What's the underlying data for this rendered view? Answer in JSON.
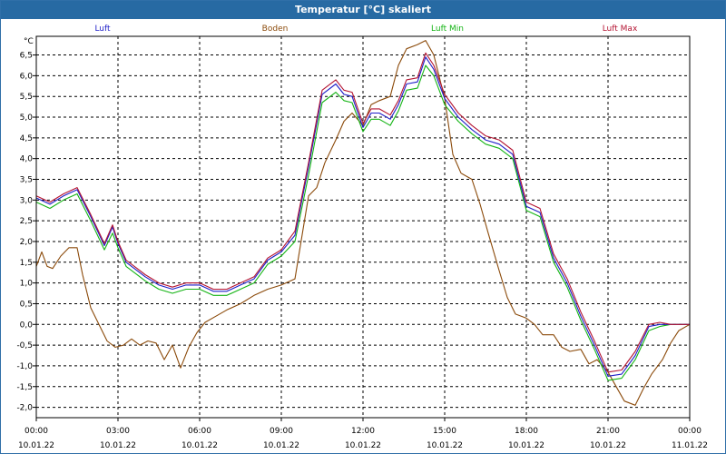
{
  "window": {
    "title": "Temperatur [°C] skaliert"
  },
  "colors": {
    "luft": "#1e1ec8",
    "boden": "#8b4a0a",
    "luft_min": "#14b414",
    "luft_max": "#b41432",
    "grid": "#000000"
  },
  "chart_data": {
    "type": "line",
    "title": "Temperatur [°C] skaliert",
    "ylabel": "°C",
    "xlabel": "",
    "xlim": [
      0,
      24
    ],
    "ylim": [
      -2.25,
      6.95
    ],
    "grid": true,
    "legend_position": "top",
    "y_ticks": [
      "6,5",
      "6,0",
      "5,5",
      "5,0",
      "4,5",
      "4,0",
      "3,5",
      "3,0",
      "2,5",
      "2,0",
      "1,5",
      "1,0",
      "0,5",
      "0,0",
      "-0,5",
      "-1,0",
      "-1,5",
      "-2,0"
    ],
    "y_tick_values": [
      6.5,
      6.0,
      5.5,
      5.0,
      4.5,
      4.0,
      3.5,
      3.0,
      2.5,
      2.0,
      1.5,
      1.0,
      0.5,
      0.0,
      -0.5,
      -1.0,
      -1.5,
      -2.0
    ],
    "x_ticks": [
      {
        "time": "00:00",
        "date": "10.01.22"
      },
      {
        "time": "03:00",
        "date": "10.01.22"
      },
      {
        "time": "06:00",
        "date": "10.01.22"
      },
      {
        "time": "09:00",
        "date": "10.01.22"
      },
      {
        "time": "12:00",
        "date": "10.01.22"
      },
      {
        "time": "15:00",
        "date": "10.01.22"
      },
      {
        "time": "18:00",
        "date": "10.01.22"
      },
      {
        "time": "21:00",
        "date": "10.01.22"
      },
      {
        "time": "00:00",
        "date": "11.01.22"
      }
    ],
    "x_tick_values": [
      0,
      3,
      6,
      9,
      12,
      15,
      18,
      21,
      24
    ],
    "series": [
      {
        "name": "Luft",
        "color": "#1e1ec8",
        "x": [
          0,
          0.5,
          1,
          1.5,
          2,
          2.5,
          2.8,
          3,
          3.3,
          3.5,
          4,
          4.5,
          5,
          5.5,
          6,
          6.5,
          7,
          7.5,
          8,
          8.5,
          9,
          9.5,
          10,
          10.5,
          11,
          11.3,
          11.6,
          12,
          12.3,
          12.6,
          13,
          13.3,
          13.6,
          14,
          14.3,
          14.6,
          15,
          15.5,
          16,
          16.5,
          17,
          17.5,
          18,
          18.5,
          19,
          19.5,
          20,
          20.5,
          21,
          21.5,
          22,
          22.5,
          22.9,
          23.3,
          23.7,
          24
        ],
        "values": [
          3.05,
          2.9,
          3.1,
          3.25,
          2.6,
          1.9,
          2.35,
          1.95,
          1.5,
          1.4,
          1.15,
          0.95,
          0.85,
          0.95,
          0.95,
          0.8,
          0.8,
          0.95,
          1.1,
          1.55,
          1.75,
          2.15,
          3.8,
          5.55,
          5.8,
          5.55,
          5.5,
          4.75,
          5.1,
          5.1,
          4.95,
          5.3,
          5.8,
          5.85,
          6.45,
          6.15,
          5.45,
          5.0,
          4.7,
          4.45,
          4.35,
          4.1,
          2.85,
          2.7,
          1.6,
          1.0,
          0.2,
          -0.5,
          -1.25,
          -1.2,
          -0.75,
          -0.05,
          0.0,
          0.0,
          0.0,
          0.0
        ]
      },
      {
        "name": "Boden",
        "color": "#8b4a0a",
        "x": [
          0,
          0.2,
          0.4,
          0.6,
          0.9,
          1.2,
          1.5,
          1.7,
          2,
          2.3,
          2.6,
          2.9,
          3.2,
          3.5,
          3.8,
          4.1,
          4.4,
          4.7,
          5,
          5.3,
          5.6,
          5.9,
          6.2,
          6.6,
          7,
          7.5,
          8,
          8.5,
          9,
          9.5,
          10,
          10.3,
          10.6,
          11,
          11.3,
          11.6,
          12,
          12.3,
          12.6,
          13,
          13.3,
          13.6,
          14,
          14.3,
          14.6,
          15,
          15.3,
          15.6,
          16,
          16.3,
          16.6,
          17,
          17.3,
          17.6,
          18,
          18.3,
          18.6,
          19,
          19.3,
          19.6,
          20,
          20.3,
          20.6,
          21,
          21.3,
          21.6,
          22,
          22.3,
          22.6,
          23,
          23.3,
          23.6,
          24
        ],
        "values": [
          1.4,
          1.75,
          1.4,
          1.35,
          1.65,
          1.85,
          1.85,
          1.2,
          0.4,
          0.0,
          -0.4,
          -0.55,
          -0.5,
          -0.35,
          -0.5,
          -0.4,
          -0.45,
          -0.85,
          -0.5,
          -1.05,
          -0.55,
          -0.2,
          0.05,
          0.2,
          0.35,
          0.5,
          0.7,
          0.85,
          0.95,
          1.1,
          3.1,
          3.3,
          3.9,
          4.45,
          4.9,
          5.1,
          4.8,
          5.3,
          5.4,
          5.5,
          6.25,
          6.65,
          6.75,
          6.85,
          6.5,
          5.45,
          4.1,
          3.65,
          3.5,
          2.9,
          2.2,
          1.3,
          0.65,
          0.25,
          0.15,
          0.0,
          -0.25,
          -0.25,
          -0.55,
          -0.65,
          -0.6,
          -0.95,
          -0.85,
          -1.15,
          -1.5,
          -1.85,
          -1.95,
          -1.55,
          -1.2,
          -0.85,
          -0.45,
          -0.15,
          0.0
        ]
      },
      {
        "name": "Luft Min",
        "color": "#14b414",
        "x": [
          0,
          0.5,
          1,
          1.5,
          2,
          2.5,
          2.8,
          3,
          3.3,
          3.5,
          4,
          4.5,
          5,
          5.5,
          6,
          6.5,
          7,
          7.5,
          8,
          8.5,
          9,
          9.5,
          10,
          10.5,
          11,
          11.3,
          11.6,
          12,
          12.3,
          12.6,
          13,
          13.3,
          13.6,
          14,
          14.3,
          14.6,
          15,
          15.5,
          16,
          16.5,
          17,
          17.5,
          18,
          18.5,
          19,
          19.5,
          20,
          20.5,
          21,
          21.5,
          22,
          22.5,
          22.9,
          23.3,
          23.7,
          24
        ],
        "values": [
          2.95,
          2.8,
          3.0,
          3.15,
          2.5,
          1.8,
          2.2,
          1.85,
          1.4,
          1.3,
          1.05,
          0.85,
          0.75,
          0.85,
          0.85,
          0.7,
          0.7,
          0.85,
          1.0,
          1.45,
          1.65,
          2.0,
          3.6,
          5.35,
          5.6,
          5.4,
          5.35,
          4.65,
          4.95,
          4.95,
          4.8,
          5.15,
          5.65,
          5.7,
          6.25,
          6.0,
          5.3,
          4.9,
          4.6,
          4.35,
          4.25,
          4.0,
          2.75,
          2.6,
          1.5,
          0.9,
          0.1,
          -0.6,
          -1.35,
          -1.3,
          -0.85,
          -0.15,
          -0.05,
          0.0,
          0.0,
          0.0
        ]
      },
      {
        "name": "Luft Max",
        "color": "#b41432",
        "x": [
          0,
          0.5,
          1,
          1.5,
          2,
          2.5,
          2.8,
          3,
          3.3,
          3.5,
          4,
          4.5,
          5,
          5.5,
          6,
          6.5,
          7,
          7.5,
          8,
          8.5,
          9,
          9.5,
          10,
          10.5,
          11,
          11.3,
          11.6,
          12,
          12.3,
          12.6,
          13,
          13.3,
          13.6,
          14,
          14.3,
          14.6,
          15,
          15.5,
          16,
          16.5,
          17,
          17.5,
          18,
          18.5,
          19,
          19.5,
          20,
          20.5,
          21,
          21.5,
          22,
          22.5,
          22.9,
          23.3,
          23.7,
          24
        ],
        "values": [
          3.1,
          2.95,
          3.15,
          3.3,
          2.65,
          1.95,
          2.4,
          2.0,
          1.55,
          1.45,
          1.2,
          1.0,
          0.9,
          1.0,
          1.0,
          0.85,
          0.85,
          1.0,
          1.15,
          1.6,
          1.8,
          2.25,
          3.9,
          5.65,
          5.9,
          5.65,
          5.6,
          4.85,
          5.2,
          5.2,
          5.05,
          5.4,
          5.9,
          5.95,
          6.55,
          6.25,
          5.55,
          5.1,
          4.8,
          4.55,
          4.45,
          4.2,
          2.95,
          2.8,
          1.7,
          1.1,
          0.3,
          -0.4,
          -1.15,
          -1.1,
          -0.65,
          0.0,
          0.05,
          0.0,
          0.0,
          0.0
        ]
      }
    ]
  }
}
